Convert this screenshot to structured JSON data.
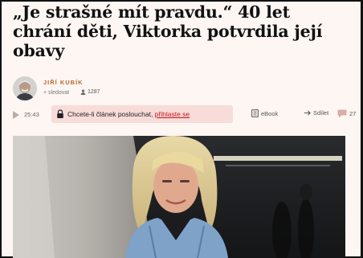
{
  "article": {
    "headline_line1": "„Je strašné mít pravdu.“ 40 let",
    "headline_line2": "chrání děti, Viktorka potvrdila její",
    "headline_line3": "obavy"
  },
  "author": {
    "name": "JIŘÍ KUBÍK",
    "follow_label": "+ sledovat",
    "followers_count": "1287",
    "avatar_icon": "author-portrait"
  },
  "toolbar": {
    "duration": "25:43",
    "listen_text": "Chcete-li článek poslouchat, ",
    "listen_link": "přihlaste se",
    "ebook_label": "eBook",
    "share_label": "Sdílet",
    "comments_count": "27"
  },
  "colors": {
    "background": "#fdf6f2",
    "accent_red": "#c4141c",
    "author_orange": "#b36a2c",
    "banner_pink": "#f8dcd9"
  }
}
